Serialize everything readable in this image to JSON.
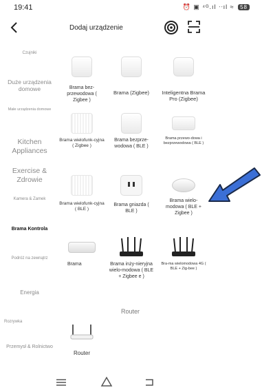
{
  "status": {
    "time": "19:41",
    "icons": "⏰ ▣ ⁴ᴳ.ıl ᐧᐧıl ≈",
    "battery": "58"
  },
  "header": {
    "title": "Dodaj urządzenie"
  },
  "sidebar": [
    {
      "label": "Czujniki",
      "size": 6
    },
    {
      "label": "Duże urządzenia domowe",
      "size": 9
    },
    {
      "label": "Małe urządzenia domowe",
      "size": 6
    },
    {
      "label": "Kitchen Appliances",
      "size": 11
    },
    {
      "label": "Exercise & Zdrowie",
      "size": 11
    },
    {
      "label": "Kamera & Zamek",
      "size": 6
    },
    {
      "label": "Brama Kontrola",
      "size": 7,
      "active": true
    },
    {
      "label": "Podróż na zewnątrz",
      "size": 6
    },
    {
      "label": "Energia",
      "size": 8
    },
    {
      "label": "Rozrywka",
      "size": 6
    },
    {
      "label": "Przemysł & Rolnictwo",
      "size": 7
    }
  ],
  "items": [
    {
      "label": "Brama bez-przewodowa ( Zigbee )",
      "icon": "gateway-box-icon",
      "size": 7
    },
    {
      "label": "Brama (Zigbee)",
      "icon": "gateway-box-icon",
      "size": 7
    },
    {
      "label": "Inteligentna Brama Pro (Zigbee)",
      "icon": "gateway-hub-icon",
      "size": 7
    },
    {
      "label": "Brama wielofunk-cyjna ( Zigbee )",
      "icon": "speaker-gateway-icon",
      "size": 7
    },
    {
      "label": "Brama bezprze-wodowa ( BLE )",
      "icon": "gateway-box-icon",
      "size": 7
    },
    {
      "label": "Brama przewo-dowa i bezprzewodowa ( BLE )",
      "icon": "gateway-flat-icon",
      "size": 6
    },
    {
      "label": "Brama wielofunk-cyjna ( BLE )",
      "icon": "speaker-gateway-icon",
      "size": 7
    },
    {
      "label": "Brama gniazda ( BLE )",
      "icon": "socket-icon",
      "size": 7
    },
    {
      "label": "Brama wielo-modowa ( BLE + Zigbee )",
      "icon": "puck-gateway-icon",
      "size": 7
    },
    {
      "label": "Brama",
      "icon": "mini-hub-icon",
      "size": 7
    },
    {
      "label": "Brama inży-nieryjna wielo-modowa ( BLE + Zigbee e )",
      "icon": "router-icon",
      "size": 7
    },
    {
      "label": "Bra-ma wielomodowa 4G ( BLE + Zig-bee )",
      "icon": "router-icon",
      "size": 6
    }
  ],
  "section": {
    "title": "Router"
  },
  "router": {
    "label": "Router",
    "icon": "router-icon"
  },
  "nav": {
    "menu": "menu-icon",
    "home": "home-icon",
    "back": "back-icon"
  }
}
